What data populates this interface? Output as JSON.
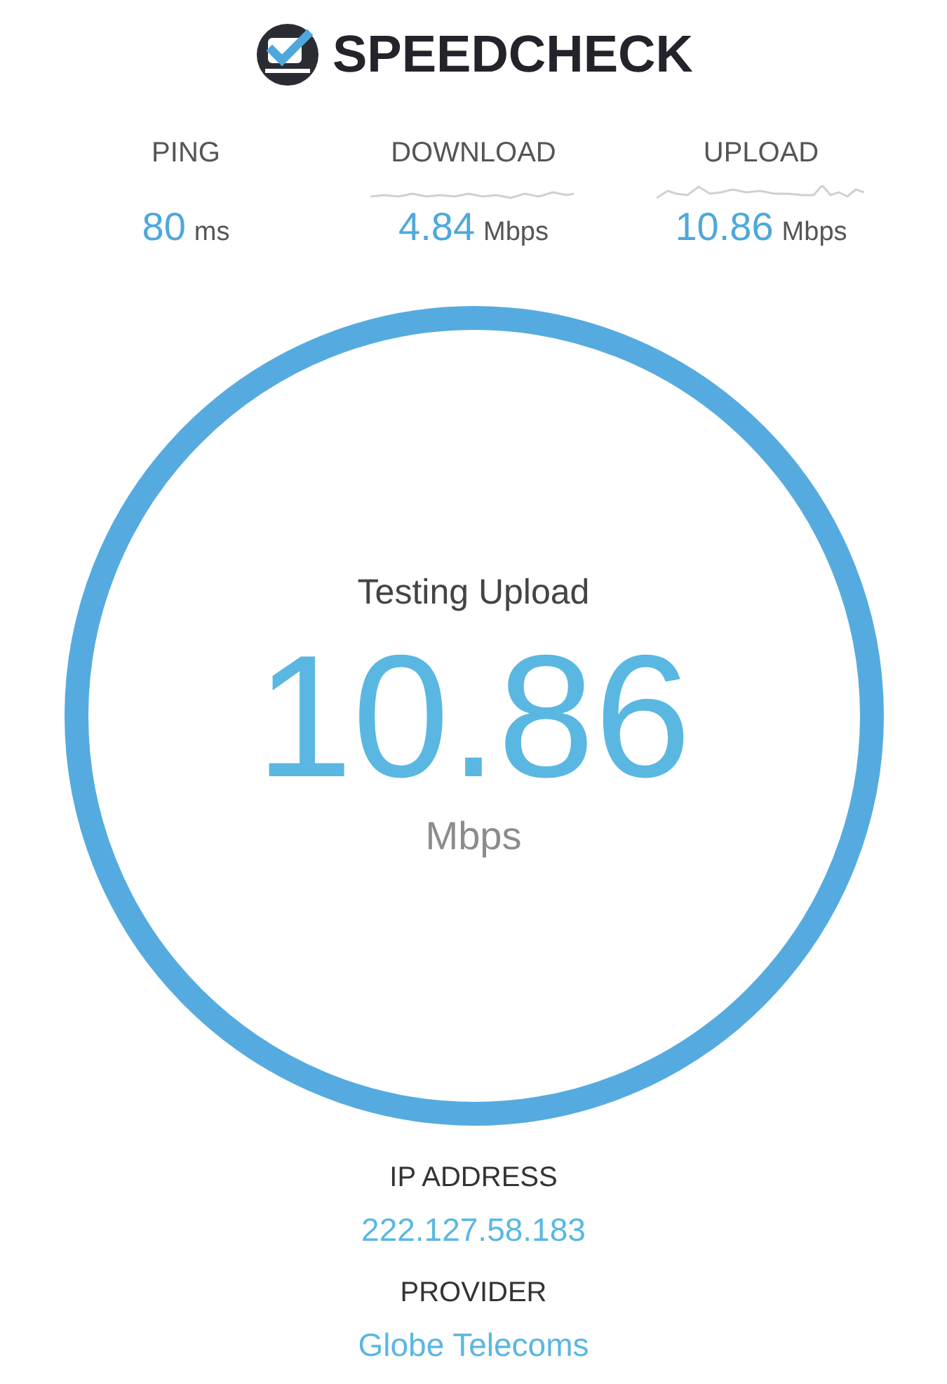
{
  "logo": {
    "name": "SPEEDCHECK"
  },
  "stats": [
    {
      "kind": "latency",
      "label": "PING",
      "value": "80",
      "unit": "ms"
    },
    {
      "kind": "rate",
      "label": "DOWNLOAD",
      "value": "4.84",
      "unit": "Mbps"
    },
    {
      "kind": "rate",
      "label": "UPLOAD",
      "value": "10.86",
      "unit": "Mbps"
    }
  ],
  "gauge": {
    "status": "Testing Upload",
    "value": "10.86",
    "unit": "Mbps"
  },
  "info": [
    {
      "label": "IP ADDRESS",
      "value": "222.127.58.183"
    },
    {
      "label": "PROVIDER",
      "value": "Globe Telecoms"
    }
  ]
}
